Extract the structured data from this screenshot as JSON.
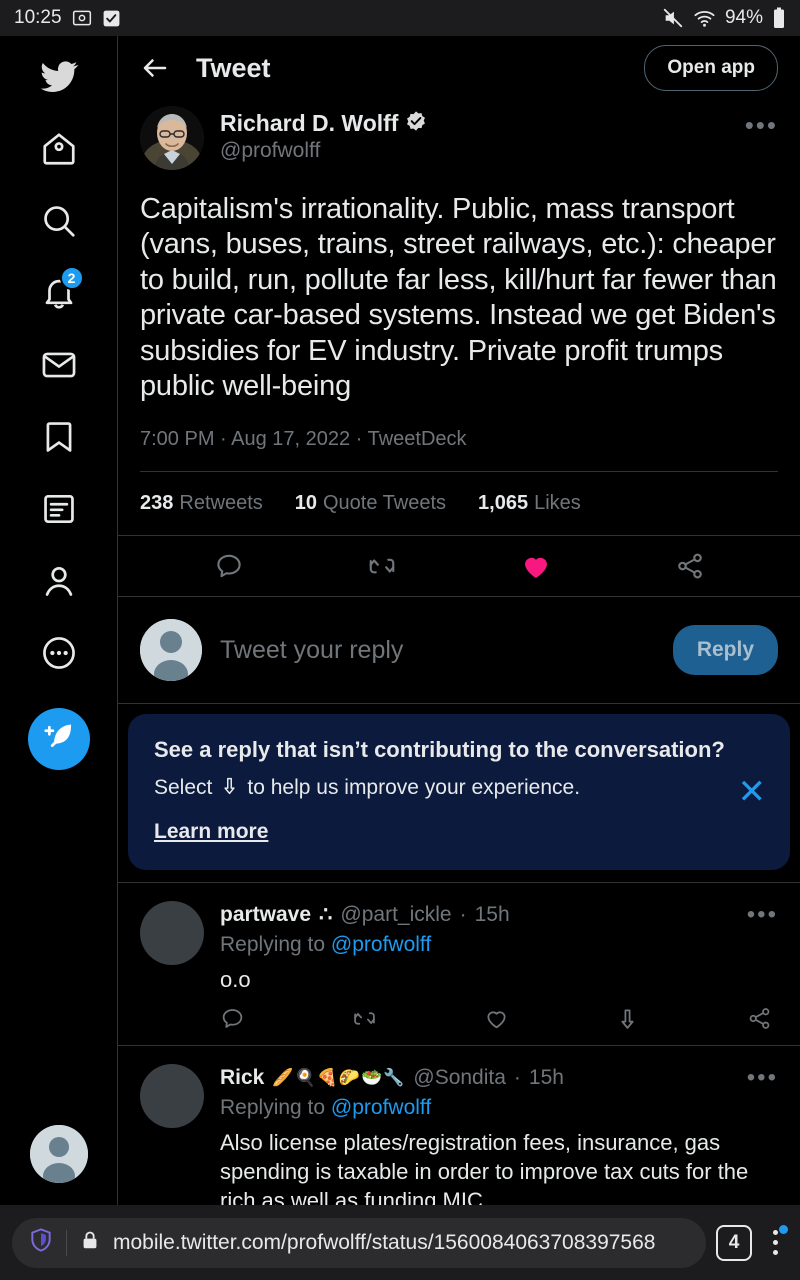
{
  "statusbar": {
    "time": "10:25",
    "battery": "94%",
    "icons": [
      "screenshot-icon",
      "checkbox-icon",
      "mute-icon",
      "wifi-icon",
      "battery-icon"
    ]
  },
  "sidebar": {
    "items": [
      {
        "name": "twitter-logo",
        "label": "Twitter"
      },
      {
        "name": "home",
        "label": "Home"
      },
      {
        "name": "search",
        "label": "Search"
      },
      {
        "name": "notifications",
        "label": "Notifications",
        "badge": "2"
      },
      {
        "name": "messages",
        "label": "Messages"
      },
      {
        "name": "bookmarks",
        "label": "Bookmarks"
      },
      {
        "name": "lists",
        "label": "Lists"
      },
      {
        "name": "profile",
        "label": "Profile"
      },
      {
        "name": "more",
        "label": "More"
      }
    ],
    "compose_label": "Tweet",
    "account_label": "Account"
  },
  "header": {
    "title": "Tweet",
    "back_label": "Back",
    "open_app_label": "Open app"
  },
  "tweet": {
    "display_name": "Richard D. Wolff",
    "verified": true,
    "handle": "@profwolff",
    "text": "Capitalism's irrationality. Public, mass transport (vans, buses, trains, street railways, etc.): cheaper to build, run, pollute far less, kill/hurt far fewer than private car-based systems. Instead we get Biden's subsidies for EV industry. Private profit trumps public well-being",
    "time": "7:00 PM",
    "date": "Aug 17, 2022",
    "client": "TweetDeck",
    "meta_separator": " · ",
    "stats": [
      {
        "count": "238",
        "label": "Retweets"
      },
      {
        "count": "10",
        "label": "Quote Tweets"
      },
      {
        "count": "1,065",
        "label": "Likes"
      }
    ],
    "actions": [
      "reply-icon",
      "retweet-icon",
      "like-icon",
      "share-icon"
    ],
    "liked": true,
    "more_label": "More"
  },
  "composer": {
    "placeholder": "Tweet your reply",
    "button_label": "Reply"
  },
  "banner": {
    "title": "See a reply that isn’t contributing to the conversation?",
    "subtitle_before": "Select",
    "subtitle_after": "to help us improve your experience.",
    "link_label": "Learn more",
    "close_label": "Dismiss"
  },
  "replies": [
    {
      "display_name": "partwave",
      "name_suffix": "∴",
      "emoji": "",
      "handle": "@part_ickle",
      "time": "15h",
      "replying_to_prefix": "Replying to ",
      "replying_to_handle": "@profwolff",
      "text": "o.o",
      "actions": [
        "reply-icon",
        "retweet-icon",
        "like-icon",
        "downvote-icon",
        "share-icon"
      ]
    },
    {
      "display_name": "Rick",
      "name_suffix": "",
      "emoji": "🥖🍳🍕🌮🥗🔧",
      "handle": "@Sondita",
      "time": "15h",
      "replying_to_prefix": "Replying to ",
      "replying_to_handle": "@profwolff",
      "text": "Also license plates/registration fees, insurance, gas spending is taxable in order to improve tax cuts for the rich as well as funding MIC.",
      "actions": [
        "reply-icon",
        "retweet-icon",
        "like-icon",
        "downvote-icon",
        "share-icon"
      ]
    }
  ],
  "browser": {
    "url": "mobile.twitter.com/profwolff/status/1560084063708397568",
    "tab_count": "4",
    "shield_label": "Tracking protection",
    "lock_label": "Secure connection",
    "menu_label": "Menu"
  },
  "colors": {
    "accent": "#1d9bf0",
    "like": "#f91880",
    "banner_bg": "#0b1a3d",
    "muted_text": "#71767b",
    "border": "#2f3336",
    "background": "#000000"
  }
}
